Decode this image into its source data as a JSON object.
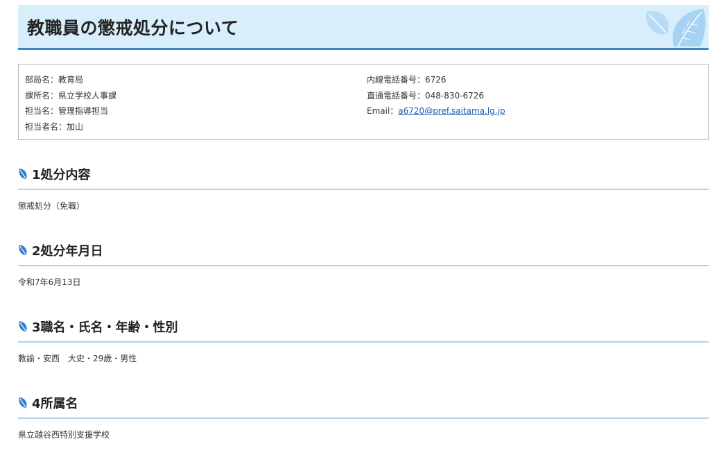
{
  "page": {
    "title": "教職員の懲戒処分について"
  },
  "contact": {
    "left": [
      "部局名：教育局",
      "課所名：県立学校人事課",
      "担当名：管理指導担当",
      "担当者名：加山"
    ],
    "right": {
      "extension": "内線電話番号：6726",
      "direct": "直通電話番号：048-830-6726",
      "email_label": "Email：",
      "email": "a6720@pref.saitama.lg.jp"
    }
  },
  "sections": [
    {
      "heading": "1処分内容",
      "body": "懲戒処分（免職）"
    },
    {
      "heading": "2処分年月日",
      "body": "令和7年6月13日"
    },
    {
      "heading": "3職名・氏名・年齢・性別",
      "body": "教諭・安西　大史・29歳・男性"
    },
    {
      "heading": "4所属名",
      "body": "県立越谷西特別支援学校"
    }
  ],
  "colors": {
    "banner_bg": "#d9eefb",
    "accent": "#3a86d1",
    "section_rule": "#a9d3f2",
    "leaf": "#2f7fd0",
    "link": "#1a5fb4"
  },
  "icons": {
    "banner_decoration": "leaf-icon",
    "section_marker": "leaf-icon"
  }
}
